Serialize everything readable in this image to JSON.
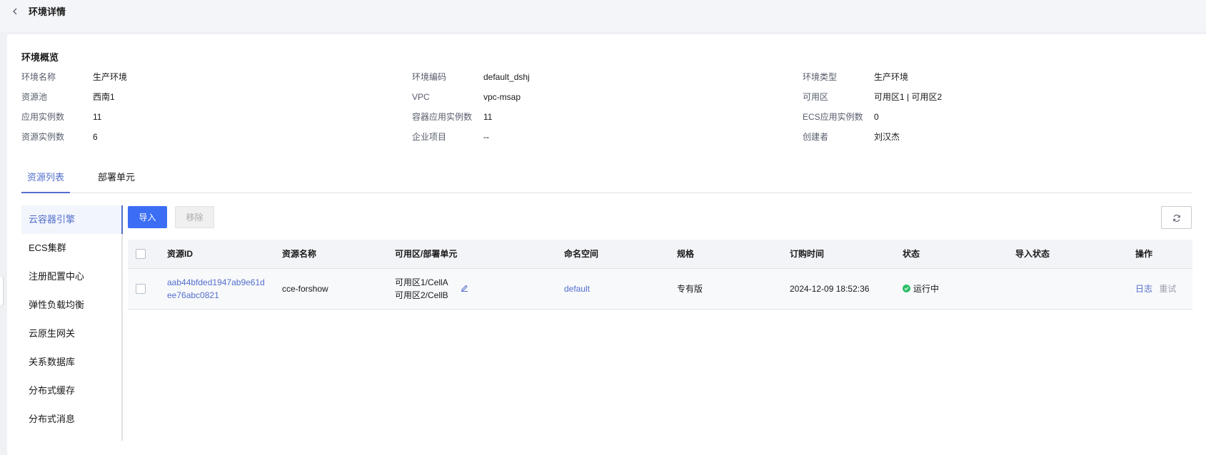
{
  "header": {
    "title": "环境详情"
  },
  "overview": {
    "title": "环境概览",
    "rows": [
      [
        {
          "label": "环境名称",
          "value": "生产环境"
        },
        {
          "label": "环境编码",
          "value": "default_dshj"
        },
        {
          "label": "环境类型",
          "value": "生产环境"
        }
      ],
      [
        {
          "label": "资源池",
          "value": "西南1"
        },
        {
          "label": "VPC",
          "value": "vpc-msap"
        },
        {
          "label": "可用区",
          "value": "可用区1 | 可用区2"
        }
      ],
      [
        {
          "label": "应用实例数",
          "value": "11"
        },
        {
          "label": "容器应用实例数",
          "value": "11"
        },
        {
          "label": "ECS应用实例数",
          "value": "0"
        }
      ],
      [
        {
          "label": "资源实例数",
          "value": "6"
        },
        {
          "label": "企业项目",
          "value": "--"
        },
        {
          "label": "创建者",
          "value": "刘汉杰"
        }
      ]
    ]
  },
  "tabs": [
    {
      "label": "资源列表",
      "active": true
    },
    {
      "label": "部署单元",
      "active": false
    }
  ],
  "sidebar": {
    "items": [
      {
        "label": "云容器引擎",
        "active": true
      },
      {
        "label": "ECS集群",
        "active": false
      },
      {
        "label": "注册配置中心",
        "active": false
      },
      {
        "label": "弹性负载均衡",
        "active": false
      },
      {
        "label": "云原生网关",
        "active": false
      },
      {
        "label": "关系数据库",
        "active": false
      },
      {
        "label": "分布式缓存",
        "active": false
      },
      {
        "label": "分布式消息",
        "active": false
      }
    ]
  },
  "toolbar": {
    "import_label": "导入",
    "remove_label": "移除"
  },
  "table": {
    "headers": {
      "id": "资源ID",
      "name": "资源名称",
      "zone": "可用区/部署单元",
      "namespace": "命名空间",
      "spec": "规格",
      "time": "订购时间",
      "status": "状态",
      "import_status": "导入状态",
      "actions": "操作"
    },
    "rows": [
      {
        "id_line1": "aab44bfded1947ab9e61d",
        "id_line2": "ee76abc0821",
        "name": "cce-forshow",
        "zone_line1": "可用区1/CellA",
        "zone_line2": "可用区2/CellB",
        "namespace": "default",
        "spec": "专有版",
        "time": "2024-12-09 18:52:36",
        "status": "运行中",
        "import_status": "",
        "action_log": "日志",
        "action_retry": "重试"
      }
    ]
  },
  "colors": {
    "accent": "#526ecc",
    "primary_button": "#3b6ef5",
    "status_running": "#2bbf6a"
  }
}
